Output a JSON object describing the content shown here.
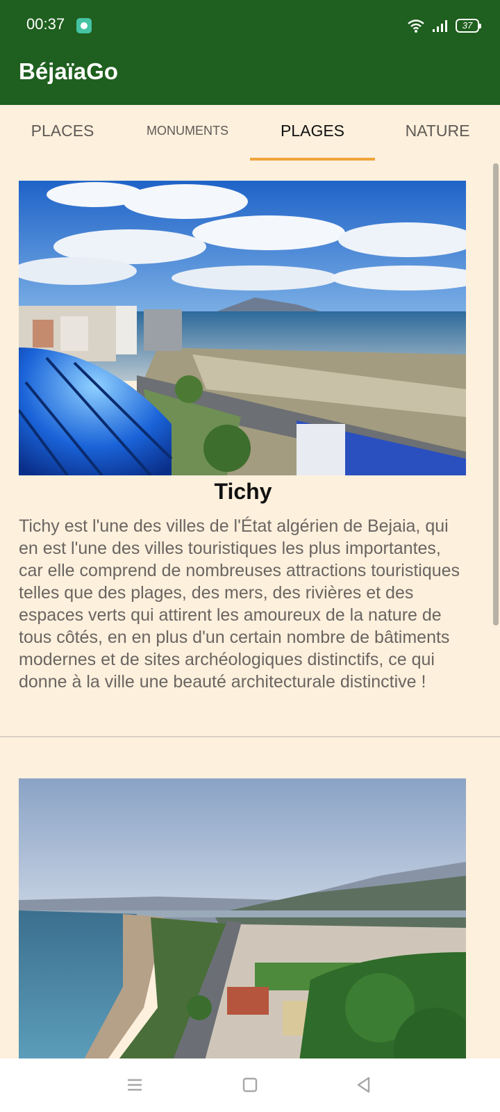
{
  "status_bar": {
    "time": "00:37",
    "battery": "37",
    "icons": [
      "message-app-icon",
      "wifi-icon",
      "signal-icon",
      "battery-icon"
    ]
  },
  "app_bar": {
    "title": "BéjaïaGo"
  },
  "tabs": [
    {
      "label": "PLACES",
      "active": false
    },
    {
      "label": "MONUMENTS",
      "active": false
    },
    {
      "label": "PLAGES",
      "active": true
    },
    {
      "label": "NATURE",
      "active": false
    }
  ],
  "cards": [
    {
      "name": "Tichy",
      "description": "Tichy est l'une des villes de l'État algérien de Bejaia, qui en est l'une des villes touristiques les plus importantes, car elle comprend de nombreuses attractions touristiques telles que des plages, des mers, des rivières et des espaces verts qui attirent les amoureux de la nature de tous côtés, en en plus d'un certain nombre de bâtiments modernes et de sites archéologiques distinctifs, ce qui donne à la ville une beauté architecturale distinctive !"
    },
    {
      "name": ""
    }
  ],
  "navigation": {
    "icons": [
      "menu-icon",
      "home-icon",
      "back-icon"
    ]
  },
  "colors": {
    "app_bar": "#1f5f1f",
    "background": "#fdf0dd",
    "tab_indicator": "#f0a43a",
    "description_text": "#6a6561"
  }
}
